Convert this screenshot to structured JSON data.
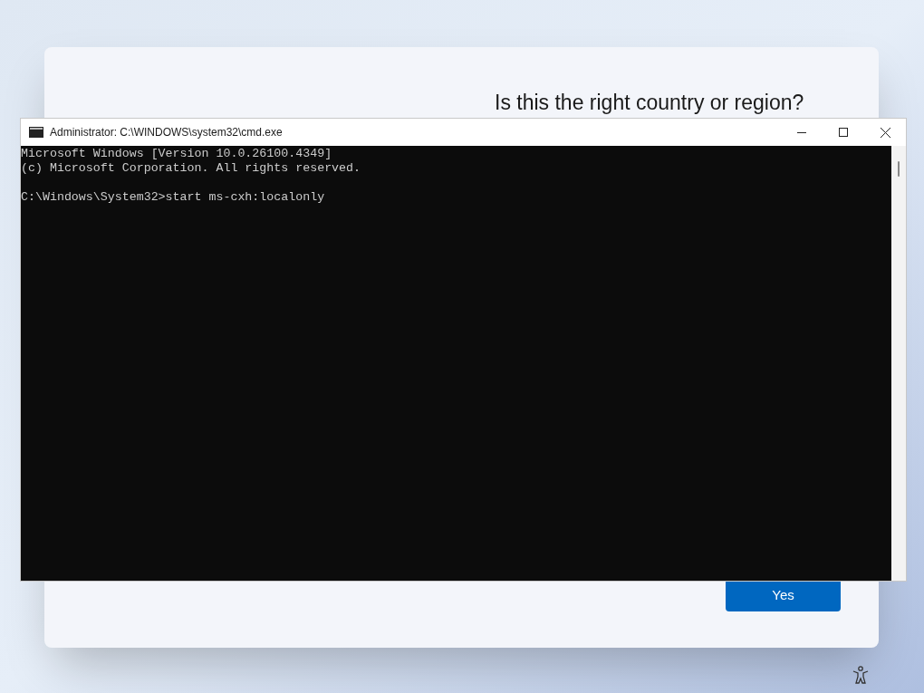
{
  "setup": {
    "heading": "Is this the right country or region?",
    "button": "Yes"
  },
  "console_window": {
    "title": "Administrator: C:\\WINDOWS\\system32\\cmd.exe",
    "output": [
      "Microsoft Windows [Version 10.0.26100.4349]",
      "(c) Microsoft Corporation. All rights reserved."
    ],
    "prompt": "C:\\Windows\\System32>start ms-cxh:localonly"
  }
}
